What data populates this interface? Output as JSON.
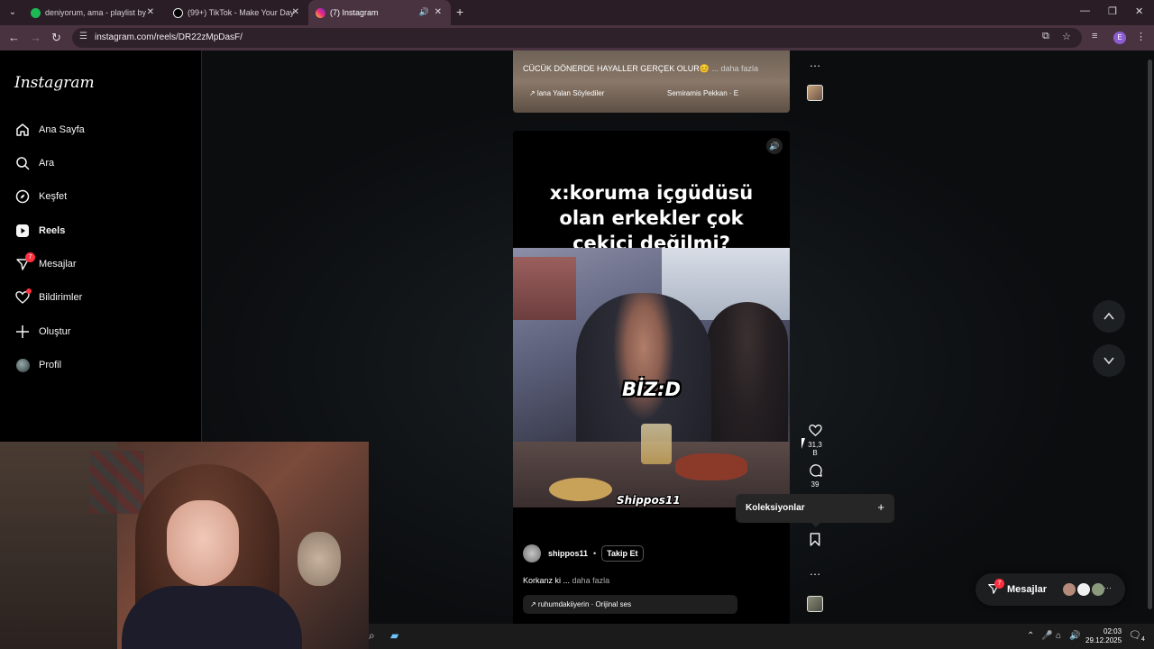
{
  "browser": {
    "tabs": [
      {
        "title": "deniyorum, ama - playlist by",
        "favicon_color": "#1db954"
      },
      {
        "title": "(99+) TikTok - Make Your Day",
        "favicon_color": "#000000"
      },
      {
        "title": "(7) Instagram",
        "favicon_color": "#e1306c",
        "active": true
      }
    ],
    "url": "instagram.com/reels/DR22zMpDasF/",
    "profile_initial": "E"
  },
  "sidebar": {
    "logo": "Instagram",
    "items": [
      {
        "label": "Ana Sayfa",
        "icon": "home-icon"
      },
      {
        "label": "Ara",
        "icon": "search-icon"
      },
      {
        "label": "Keşfet",
        "icon": "compass-icon"
      },
      {
        "label": "Reels",
        "icon": "reels-icon"
      },
      {
        "label": "Mesajlar",
        "icon": "messenger-icon",
        "badge": "7"
      },
      {
        "label": "Bildirimler",
        "icon": "heart-icon"
      },
      {
        "label": "Oluştur",
        "icon": "plus-icon"
      },
      {
        "label": "Profil",
        "icon": "avatar"
      }
    ]
  },
  "prev_reel": {
    "caption": "CÜCÜK DÖNERDE HAYALLER GERÇEK OLUR😊",
    "more": "... daha fazla",
    "audio1": "↗ lana Yalan Söylediler",
    "audio2": "Semiramis Pekkan · E"
  },
  "reel": {
    "title": "x:koruma içgüdüsü olan erkekler çok çekici değilmi?",
    "overlay_text": "BİZ:D",
    "watermark": "Shippos11",
    "owner": "shippos11",
    "separator": "•",
    "follow_label": "Takip Et",
    "caption": "Korkanz ki ...",
    "caption_more": "daha fazla",
    "audio": "↗ ruhumdakiiyerin · Orijinal ses"
  },
  "actions": {
    "likes": "31,3 B",
    "comments": "39"
  },
  "collections": {
    "label": "Koleksiyonlar",
    "add": "+"
  },
  "messages_float": {
    "label": "Mesajlar",
    "badge": "7"
  },
  "taskbar": {
    "time": "02:03",
    "date": "29.12.2025",
    "notif_count": "4"
  }
}
